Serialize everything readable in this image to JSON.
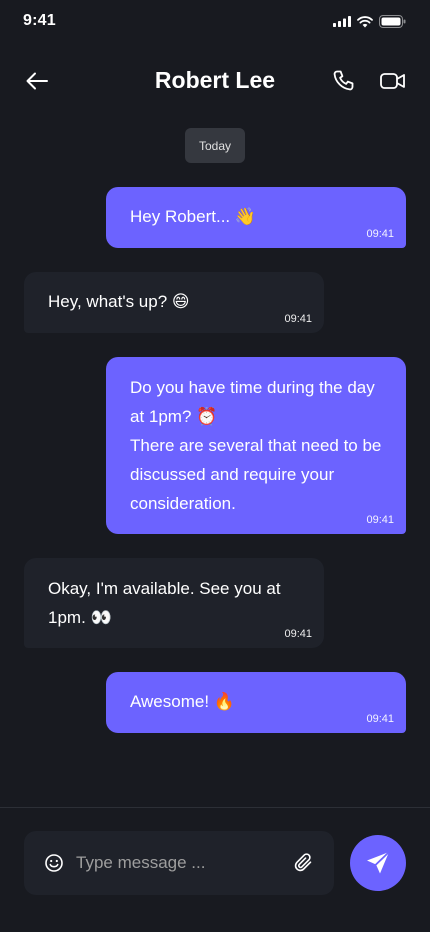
{
  "status_bar": {
    "time": "9:41"
  },
  "header": {
    "title": "Robert Lee"
  },
  "date_chip": "Today",
  "messages": [
    {
      "direction": "sent",
      "text": "Hey Robert... 👋",
      "time": "09:41"
    },
    {
      "direction": "received",
      "text": "Hey, what's up? 😄",
      "time": "09:41"
    },
    {
      "direction": "sent",
      "text": "Do you have time during the day at 1pm? ⏰\nThere are several that need to be discussed and require your consideration.",
      "time": "09:41"
    },
    {
      "direction": "received",
      "text": "Okay, I'm available. See you at 1pm. 👀",
      "time": "09:41"
    },
    {
      "direction": "sent",
      "text": "Awesome! 🔥",
      "time": "09:41"
    }
  ],
  "composer": {
    "placeholder": "Type message ..."
  },
  "colors": {
    "background": "#181a20",
    "accent": "#6c63ff",
    "received_bubble": "#1f222a",
    "date_chip": "#35383f"
  },
  "icons": {
    "back": "arrow-left-icon",
    "call": "phone-icon",
    "video": "video-icon",
    "emoji": "smiley-icon",
    "attach": "paperclip-icon",
    "send": "send-icon"
  }
}
